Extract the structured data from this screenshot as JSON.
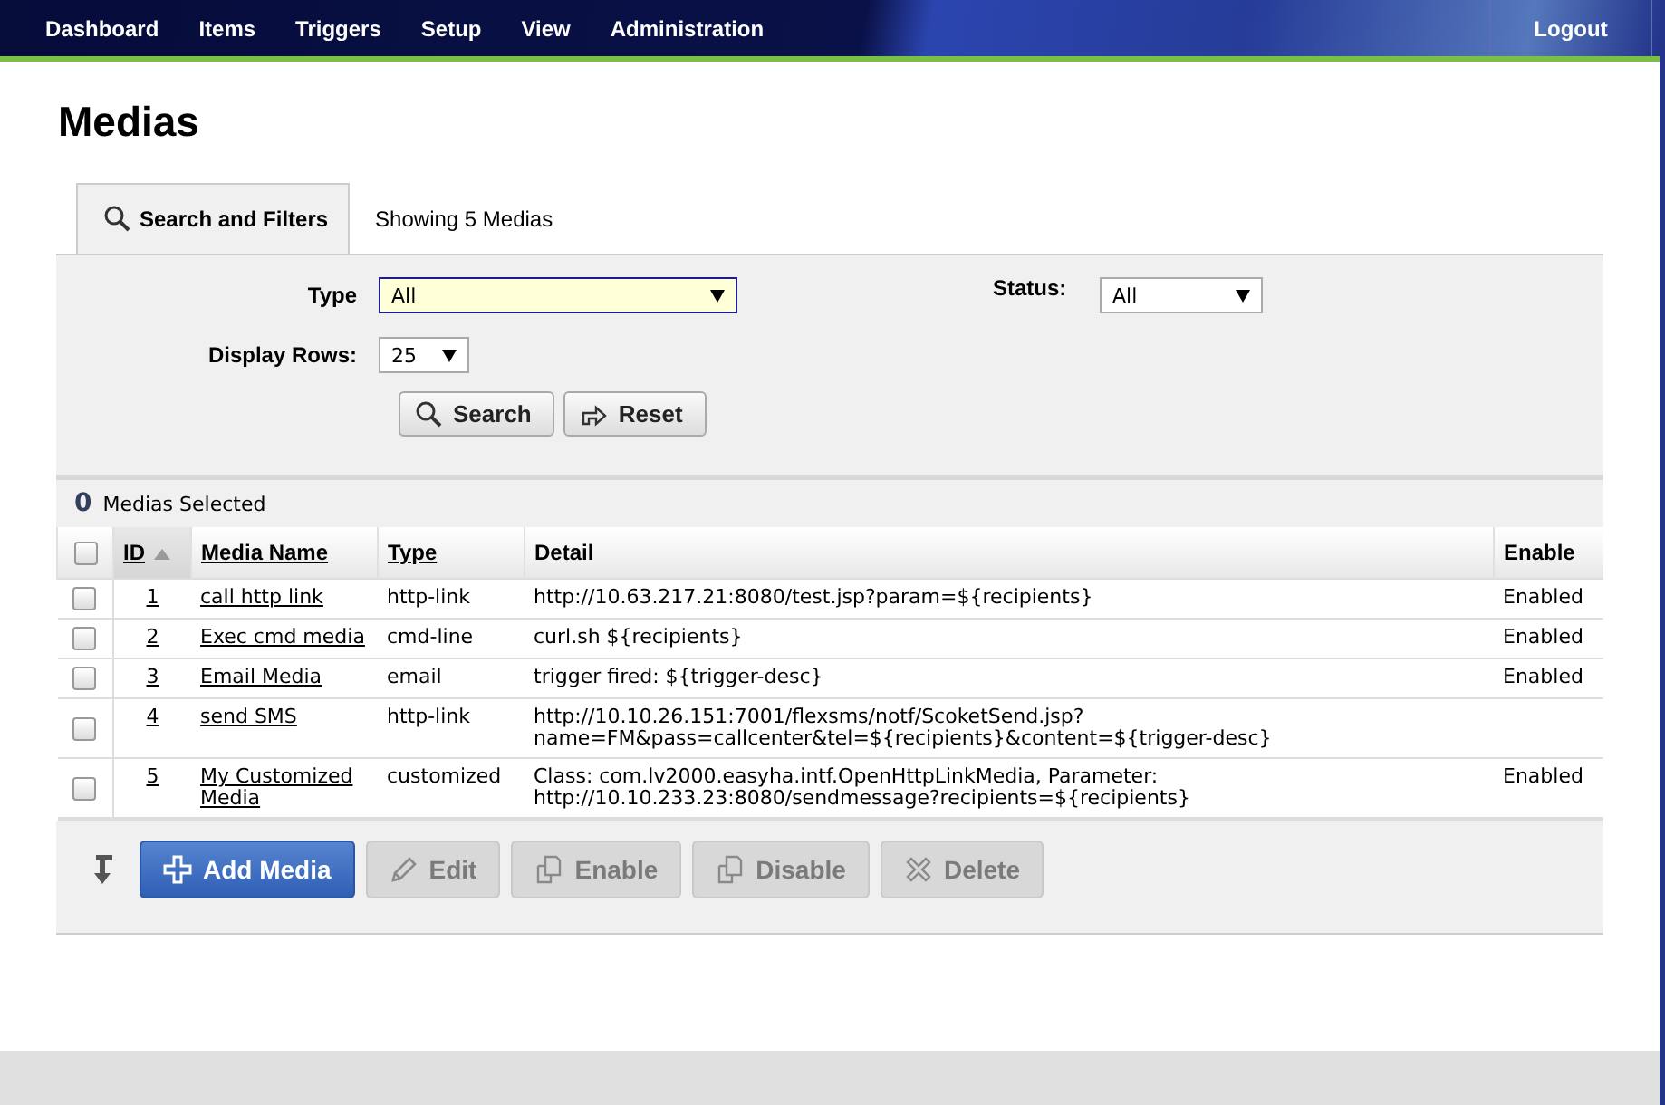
{
  "nav": {
    "items": [
      {
        "label": "Dashboard",
        "selected": false
      },
      {
        "label": "Items",
        "selected": false
      },
      {
        "label": "Triggers",
        "selected": false
      },
      {
        "label": "Setup",
        "selected": false
      },
      {
        "label": "View",
        "selected": false
      },
      {
        "label": "Administration",
        "selected": false
      }
    ],
    "logout": "Logout"
  },
  "page_title": "Medias",
  "tabs": [
    {
      "label": "Search and Filters",
      "selected": true,
      "kind": "search"
    },
    {
      "label": "Showing 5 Medias",
      "selected": false
    }
  ],
  "filters": {
    "type": {
      "label": "Type",
      "value": "All"
    },
    "status": {
      "label": "Status:",
      "value": "All"
    },
    "rows": {
      "label": "Display Rows:",
      "value": "25"
    },
    "buttons": [
      {
        "label": "Search",
        "kind": "search"
      },
      {
        "label": "Reset",
        "kind": "reset"
      }
    ]
  },
  "selection": {
    "count": "0",
    "label": "Medias Selected"
  },
  "table": {
    "select_all_checked": false,
    "columns": [
      {
        "label": "ID",
        "sortable": true,
        "sorted": true
      },
      {
        "label": "Media Name",
        "sortable": true,
        "sorted": false
      },
      {
        "label": "Type",
        "sortable": true,
        "sorted": false
      },
      {
        "label": "Detail",
        "sortable": false,
        "sorted": false
      },
      {
        "label": "Enable",
        "sortable": false,
        "sorted": false
      }
    ],
    "rows": [
      {
        "checked": false,
        "id": "1",
        "name": "call http link",
        "type": "http-link",
        "detail": [
          "http://10.63.217.21:8080/test.jsp?param=${recipients}"
        ],
        "enable": "Enabled"
      },
      {
        "checked": false,
        "id": "2",
        "name": "Exec cmd media",
        "type": "cmd-line",
        "detail": [
          "curl.sh ${recipients}"
        ],
        "enable": "Enabled"
      },
      {
        "checked": false,
        "id": "3",
        "name": "Email Media",
        "type": "email",
        "detail": [
          "trigger fired: ${trigger-desc}"
        ],
        "enable": "Enabled"
      },
      {
        "checked": false,
        "id": "4",
        "name": "send SMS",
        "type": "http-link",
        "detail": [
          "http://10.10.26.151:7001/flexsms/notf/ScoketSend.jsp?",
          "name=FM&pass=callcenter&tel=${recipients}&content=${trigger-desc}"
        ]
      },
      {
        "checked": false,
        "id": "5",
        "name": "My Customized Media",
        "type": "customized",
        "detail": [
          "Class: com.lv2000.easyha.intf.OpenHttpLinkMedia, Parameter:",
          "http://10.10.233.23:8080/sendmessage?recipients=${recipients}"
        ],
        "enable": "Enabled"
      }
    ]
  },
  "actions": [
    {
      "label": "Add Media",
      "kind": "add",
      "disabled": false
    },
    {
      "label": "Edit",
      "kind": "edit",
      "disabled": true
    },
    {
      "label": "Enable",
      "kind": "enable",
      "disabled": true
    },
    {
      "label": "Disable",
      "kind": "disable",
      "disabled": true
    },
    {
      "label": "Delete",
      "kind": "delete",
      "disabled": true
    }
  ]
}
